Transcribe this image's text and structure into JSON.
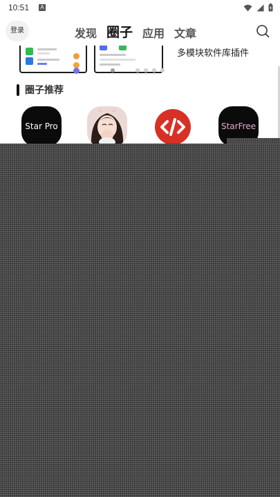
{
  "status_bar": {
    "time": "10:51",
    "notification_badge": "A",
    "icons": [
      "wifi-icon",
      "signal-icon",
      "battery-icon"
    ]
  },
  "header": {
    "login_label": "登录",
    "tabs": [
      {
        "label": "发现",
        "active": false
      },
      {
        "label": "圈子",
        "active": true
      },
      {
        "label": "应用",
        "active": false
      },
      {
        "label": "文章",
        "active": false
      }
    ],
    "search_icon": "search-icon"
  },
  "banner": {
    "title": "多模块软件库插件",
    "page_count": 5,
    "active_page": 1
  },
  "section": {
    "title": "圈子推荐"
  },
  "circles": [
    {
      "name": "Star Pro",
      "logo_text": "Star Pro",
      "icon": "starpro-logo",
      "color": "#0b0b0b"
    },
    {
      "name": "avatar",
      "logo_text": "",
      "icon": "girl-avatar",
      "color": "#e9dcd8"
    },
    {
      "name": "code",
      "logo_text": "",
      "icon": "code-icon",
      "color": "#d93025"
    },
    {
      "name": "StarFree",
      "logo_text": "StarFree",
      "icon": "starfree-logo",
      "color": "#0b0b0b"
    }
  ]
}
